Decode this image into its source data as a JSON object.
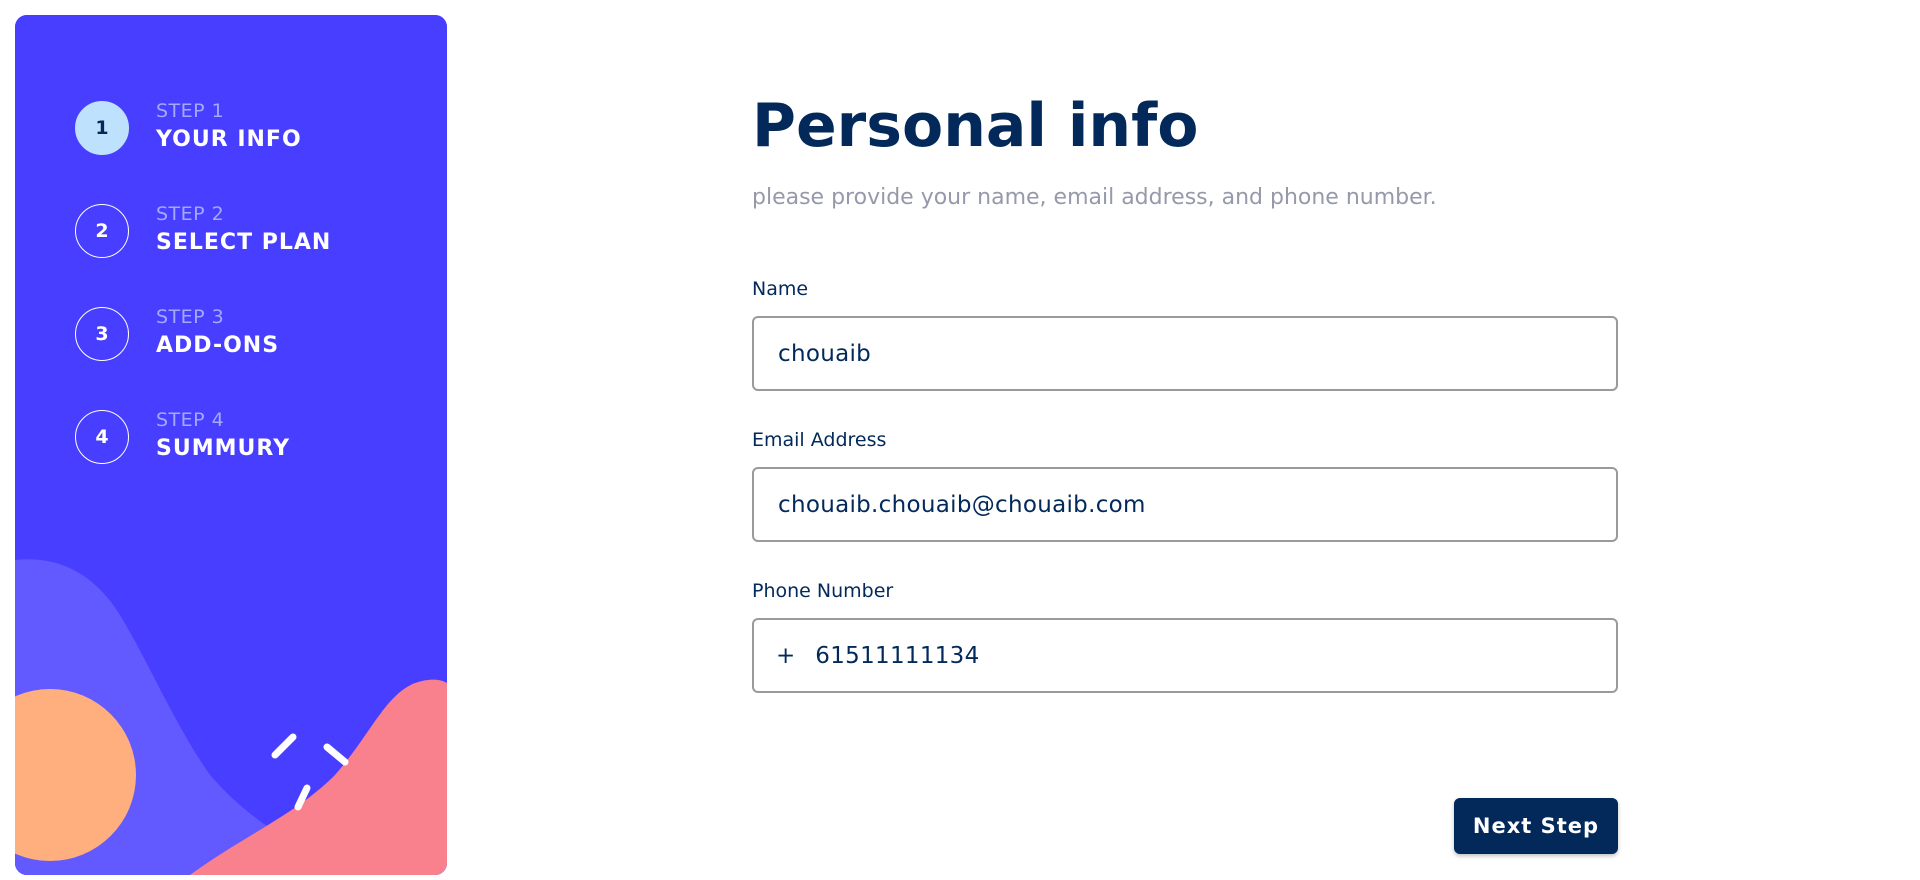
{
  "sidebar": {
    "steps": [
      {
        "number": "1",
        "caption": "STEP 1",
        "title": "YOUR INFO"
      },
      {
        "number": "2",
        "caption": "STEP 2",
        "title": "SELECT PLAN"
      },
      {
        "number": "3",
        "caption": "STEP 3",
        "title": "ADD-ONS"
      },
      {
        "number": "4",
        "caption": "STEP 4",
        "title": "SUMMURY"
      }
    ],
    "active_step": 1
  },
  "main": {
    "title": "Personal info",
    "subtitle": "please provide your name, email address, and phone number.",
    "fields": {
      "name": {
        "label": "Name",
        "value": "chouaib"
      },
      "email": {
        "label": "Email Address",
        "value": "chouaib.chouaib@chouaib.com"
      },
      "phone": {
        "label": "Phone Number",
        "prefix": "+",
        "value": "61511111134"
      }
    },
    "next_button": "Next Step"
  },
  "colors": {
    "sidebar_bg": "#483eff",
    "sidebar_wave": "#6259ff",
    "orange_circle": "#ffaf7e",
    "pink_blob": "#f9818e",
    "marine_blue": "#02295a",
    "light_blue": "#bee2fd",
    "cool_gray": "#9699ab"
  }
}
